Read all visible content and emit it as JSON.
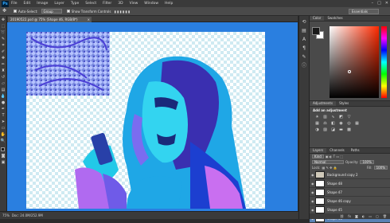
{
  "app": {
    "logo": "Ps"
  },
  "menu": [
    "File",
    "Edit",
    "Image",
    "Layer",
    "Type",
    "Select",
    "Filter",
    "3D",
    "View",
    "Window",
    "Help"
  ],
  "window_controls": [
    "–",
    "□",
    "✕"
  ],
  "options": {
    "auto_select_label": "Auto-Select:",
    "auto_select_value": "Group",
    "transform_label": "Show Transform Controls",
    "workspace": "Essentials"
  },
  "document": {
    "tab_title": "20190522.psd @ 75% (Shape 46, RGB/8*)",
    "close": "×"
  },
  "status": {
    "zoom": "75%",
    "doc_info": "Doc: 24.0M/252.9M"
  },
  "panels": {
    "color_tabs": [
      "Color",
      "Swatches"
    ],
    "adjust_tabs": [
      "Adjustments",
      "Styles"
    ],
    "adjust_title": "Add an adjustment",
    "layers_tabs": [
      "Layers",
      "Channels",
      "Paths"
    ],
    "kind_label": "Kind",
    "blend_mode": "Normal",
    "opacity_label": "Opacity:",
    "opacity_value": "100%",
    "lock_label": "Lock:",
    "fill_label": "Fill:",
    "fill_value": "100%",
    "layers": [
      {
        "name": "Background copy 2"
      },
      {
        "name": "Shape 48"
      },
      {
        "name": "Shape 47"
      },
      {
        "name": "Shape 46 copy"
      },
      {
        "name": "Shape 45"
      },
      {
        "name": "Shape 46"
      }
    ],
    "footer_icons": [
      "link",
      "fx",
      "mask",
      "adj",
      "folder",
      "new",
      "trash"
    ]
  },
  "colors": {
    "fg": "#1a1a1a",
    "bg": "#ffffff",
    "canvas_bg": "#2a7fe0",
    "selected_layer": "#5a82b4"
  }
}
